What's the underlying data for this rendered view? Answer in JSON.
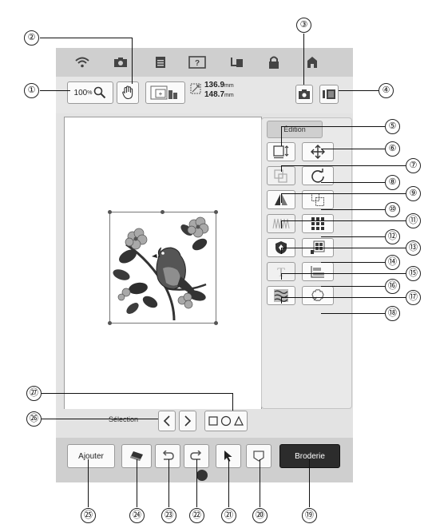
{
  "topbar": {
    "zoom": "100",
    "zoom_unit": "%",
    "size_width": "136.9",
    "size_height": "148.7",
    "unit": "mm"
  },
  "panel": {
    "tab_label": "Édition"
  },
  "selection": {
    "label": "Sélection"
  },
  "bottom": {
    "add_label": "Ajouter",
    "embroider_label": "Broderie"
  },
  "callouts": {
    "n1": "①",
    "n2": "②",
    "n3": "③",
    "n4": "④",
    "n5": "⑤",
    "n6": "⑥",
    "n7": "⑦",
    "n8": "⑧",
    "n9": "⑨",
    "n10": "⑩",
    "n11": "⑪",
    "n12": "⑫",
    "n13": "⑬",
    "n14": "⑭",
    "n15": "⑮",
    "n16": "⑯",
    "n17": "⑰",
    "n18": "⑱",
    "n19": "⑲",
    "n20": "⑳",
    "n21": "㉑",
    "n22": "㉒",
    "n23": "㉓",
    "n24": "㉔",
    "n25": "㉕",
    "n26": "㉖",
    "n27": "㉗"
  },
  "colors": {
    "embroider_button": "#2c2c2c",
    "screen_bg": "#d4d4d4",
    "leaf": "#3c3c3c",
    "flower": "#a9a9a9"
  }
}
